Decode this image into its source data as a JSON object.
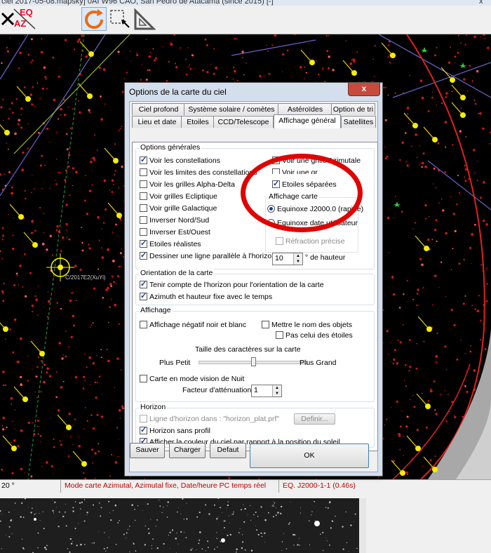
{
  "window": {
    "title": "ciel 2017-05-08.mapsky]   0AI W96 CAO, San Pedro de Atacama (since 2015) [-]",
    "close_label": "x"
  },
  "toolbar": {
    "eq_label": "EQ",
    "az_label": "AZ"
  },
  "map": {
    "comet_label": "C/2017E2(XuYi)",
    "colors": {
      "constellation_line": "#6b63c8",
      "ecliptic": "#c8c800",
      "horizon": "#e02020",
      "meridian": "#1a8a1a"
    }
  },
  "status": {
    "left": "20 °",
    "mode": "Mode carte Azimutal, Azimutal fixe, Date/heure PC temps réel",
    "eq": "EQ. J2000-1-1 (0.46s)"
  },
  "dialog": {
    "title": "Options de la carte du ciel",
    "close": "x",
    "tabs_row1": [
      "Ciel profond",
      "Système solaire / comètes",
      "Astéroïdes",
      "Option de tri"
    ],
    "tabs_row2": [
      "Lieu et date",
      "Etoiles",
      "CCD/Telescope",
      "Affichage général",
      "Satellites"
    ],
    "active_tab": "Affichage général",
    "general": {
      "title": "Options générales",
      "options": [
        {
          "label": "Voir les constellations",
          "checked": true
        },
        {
          "label": "Voir les limites des constellations",
          "checked": false
        },
        {
          "label": "Voir les grilles Alpha-Delta",
          "checked": false
        },
        {
          "label": "Voir grilles Ecliptique",
          "checked": false
        },
        {
          "label": "Voir grille Galactique",
          "checked": false
        },
        {
          "label": "Inverser Nord/Sud",
          "checked": false
        },
        {
          "label": "Inverser Est/Ouest",
          "checked": false
        },
        {
          "label": "Etoiles réalistes",
          "checked": true
        },
        {
          "label": "Dessiner une ligne parallèle à l'horizon",
          "checked": true
        }
      ],
      "azimutal_grid": {
        "label": "Voir une grille Azimutale",
        "checked": false
      },
      "hidden_option": {
        "label": "Voir une gr...",
        "checked": false
      },
      "separated_stars": {
        "label": "Etoiles séparées",
        "checked": true
      },
      "horizon_line_value": "10",
      "horizon_line_unit": "° de hauteur",
      "map_display": {
        "title": "Affichage carte",
        "options": [
          {
            "label": "Equinoxe J2000.0 (rapide)",
            "selected": true
          },
          {
            "label": "Equinoxe date utilisateur",
            "selected": false
          }
        ],
        "refraction": {
          "label": "Réfraction précise",
          "checked": false,
          "disabled": true
        }
      }
    },
    "orientation": {
      "title": "Orientation de la carte",
      "options": [
        {
          "label": "Tenir compte de l'horizon pour l'orientation de la carte",
          "checked": true
        },
        {
          "label": "Azimuth et hauteur fixe avec le temps",
          "checked": true
        }
      ]
    },
    "display": {
      "title": "Affichage",
      "negative": {
        "label": "Affichage négatif noir et blanc",
        "checked": false
      },
      "object_names": {
        "label": "Mettre le nom des objets",
        "checked": false
      },
      "not_stars": {
        "label": "Pas celui des étoiles",
        "checked": false
      },
      "font_size_title": "Taille des caractères sur la carte",
      "smaller": "Plus Petit",
      "larger": "Plus Grand",
      "font_size_level": 0.5,
      "night_mode": {
        "label": "Carte en mode vision de Nuit",
        "checked": false
      },
      "attenuation_label": "Facteur d'atténuation",
      "attenuation_value": "1"
    },
    "horizon": {
      "title": "Horizon",
      "horizon_line": {
        "label": "Ligne d'horizon dans : \"horizon_plat.prf\"",
        "checked": false,
        "disabled": true
      },
      "define_button": "Definir...",
      "no_profile": {
        "label": "Horizon sans profil",
        "checked": true
      },
      "sky_color": {
        "label": "Afficher la couleur du ciel par rapport à la position du soleil",
        "checked": true
      }
    },
    "buttons": {
      "save": "Sauver",
      "load": "Charger",
      "default": "Defaut",
      "ok": "OK"
    }
  }
}
